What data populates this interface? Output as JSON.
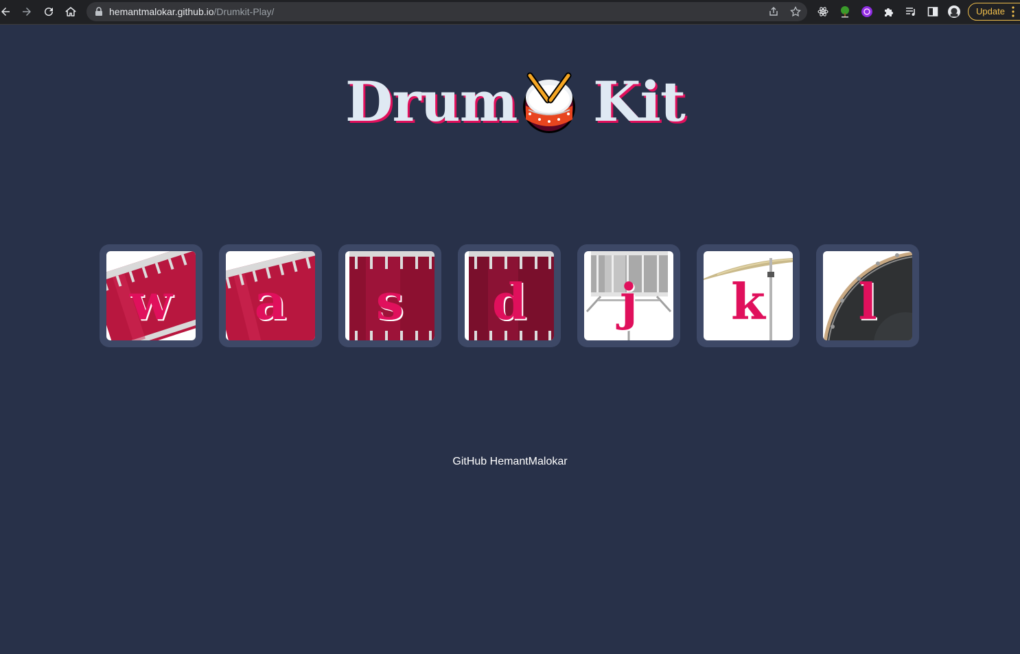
{
  "browser": {
    "url_domain": "hemantmalokar.github.io",
    "url_path": "/Drumkit-Play/",
    "update_label": "Update"
  },
  "page": {
    "title_left": "Drum",
    "title_right": "Kit",
    "footer_text": "GitHub HemantMalokar"
  },
  "keys": [
    {
      "letter": "w",
      "icon": "tom-tom-1"
    },
    {
      "letter": "a",
      "icon": "tom-tom-2"
    },
    {
      "letter": "s",
      "icon": "tom-tom-3"
    },
    {
      "letter": "d",
      "icon": "tom-tom-4"
    },
    {
      "letter": "j",
      "icon": "snare"
    },
    {
      "letter": "k",
      "icon": "crash"
    },
    {
      "letter": "l",
      "icon": "kick"
    }
  ],
  "colors": {
    "background": "#283149",
    "key_frame": "#3d4866",
    "accent": "#e0105c",
    "title_text": "#dfe9f3"
  }
}
